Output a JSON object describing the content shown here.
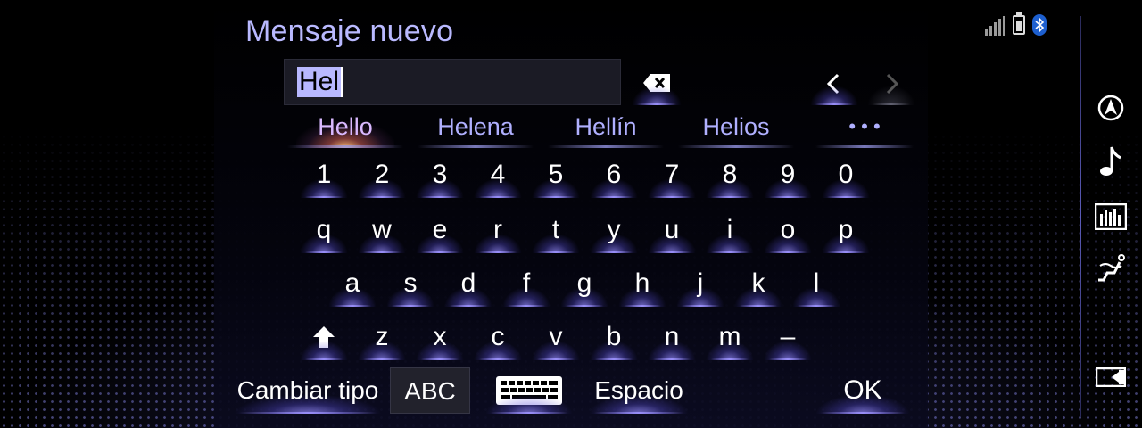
{
  "header": {
    "title": "Mensaje nuevo"
  },
  "input": {
    "value": "Hel"
  },
  "suggestions": [
    "Hello",
    "Helena",
    "Hellín",
    "Helios",
    "• • •"
  ],
  "keyboard": {
    "row_numbers": [
      "1",
      "2",
      "3",
      "4",
      "5",
      "6",
      "7",
      "8",
      "9",
      "0"
    ],
    "row_q": [
      "q",
      "w",
      "e",
      "r",
      "t",
      "y",
      "u",
      "i",
      "o",
      "p"
    ],
    "row_a": [
      "a",
      "s",
      "d",
      "f",
      "g",
      "h",
      "j",
      "k",
      "l"
    ],
    "row_z": [
      "z",
      "x",
      "c",
      "v",
      "b",
      "n",
      "m",
      "–"
    ]
  },
  "bottom": {
    "change_type_label": "Cambiar tipo",
    "abc_label": "ABC",
    "space_label": "Espacio",
    "ok_label": "OK"
  },
  "icons": {
    "backspace": "backspace-icon",
    "nav_left": "chevron-left-icon",
    "nav_right": "chevron-right-icon",
    "shift": "shift-arrow-icon",
    "keyboard": "keyboard-icon",
    "status": [
      "signal-icon",
      "battery-icon",
      "bluetooth-icon"
    ],
    "sidebar": [
      "navigation-icon",
      "music-note-icon",
      "equalizer-icon",
      "seat-climate-icon",
      "display-icon"
    ]
  },
  "colors": {
    "title": "#b9b9ff",
    "suggestion": "#b0b0ff",
    "selection": "#b8b8ff",
    "bluetooth": "#1d5fcf"
  }
}
